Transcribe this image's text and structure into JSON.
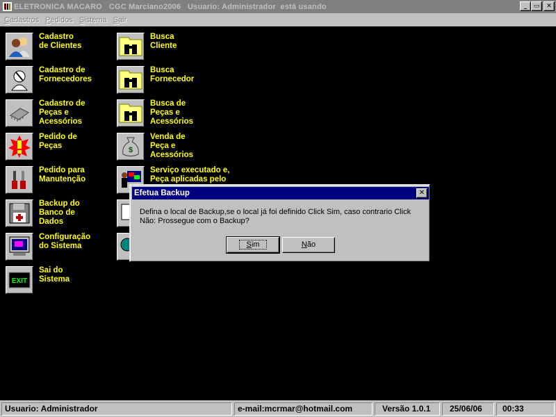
{
  "titlebar": {
    "text": "ELETRONICA MACARO   CGC Marciano2006   Usuario: Administrador  está usando",
    "minimize": "_",
    "restore": "▭",
    "close": "✕"
  },
  "menu": [
    "Cadastros",
    "Pedidos",
    "Sistema",
    "Sair"
  ],
  "tiles_left": [
    {
      "label": "Cadastro\nde Clientes",
      "icon": "clients-icon"
    },
    {
      "label": "Cadastro de\nFornecedores",
      "icon": "supplier-icon"
    },
    {
      "label": "Cadastro de\nPeças e\nAcessórios",
      "icon": "chip-icon"
    },
    {
      "label": "Pedido de\nPeças",
      "icon": "alert-icon"
    },
    {
      "label": "Pedido para\nManutenção",
      "icon": "tools-icon"
    },
    {
      "label": "Backup do\nBanco de\nDados",
      "icon": "floppy-icon"
    },
    {
      "label": "Configuração\ndo Sistema",
      "icon": "monitor-icon"
    },
    {
      "label": "Sai do\nSistema",
      "icon": "exit-icon"
    }
  ],
  "tiles_right": [
    {
      "label": "Busca\nCliente",
      "icon": "binoculars-icon"
    },
    {
      "label": "Busca\nFornecedor",
      "icon": "binoculars-icon"
    },
    {
      "label": "Busca de\nPeças e\nAcessórios",
      "icon": "binoculars-icon"
    },
    {
      "label": "Venda de\nPeça e\nAcessórios",
      "icon": "money-bag-icon"
    },
    {
      "label": "Serviço executado e,\nPeça aplicadas pelo",
      "icon": "service-icon"
    }
  ],
  "exit_icon_text": "EXIT",
  "dialog": {
    "title": "Efetua Backup",
    "close": "✕",
    "message": "Defina o local de Backup,se o local já foi definido Click Sim, caso contrario Click Não: Prossegue com o Backup?",
    "yes": "Sim",
    "no": "Não"
  },
  "statusbar": {
    "user": "Usuario: Administrador",
    "email": "e-mail:mcrmar@hotmail.com",
    "version": "Versão 1.0.1",
    "date": "25/06/06",
    "time": "00:33"
  }
}
